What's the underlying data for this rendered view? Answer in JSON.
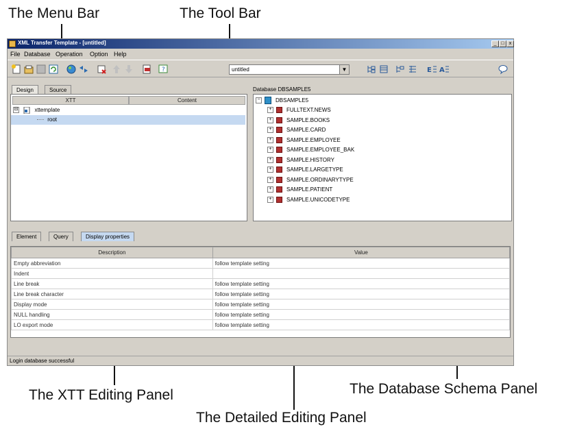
{
  "callouts": {
    "menu_bar": "The Menu Bar",
    "tool_bar": "The Tool Bar",
    "xtt_panel": "The XTT Editing Panel",
    "db_schema_panel": "The Database Schema Panel",
    "detailed_panel": "The Detailed Editing Panel"
  },
  "window": {
    "title": "XML Transfer Template - [untitled]",
    "controls": [
      "_",
      "□",
      "x"
    ]
  },
  "menu": [
    "File",
    "Database",
    "Operation",
    "Option",
    "Help"
  ],
  "toolbar": {
    "template_select_value": "untitled",
    "icons": [
      "new-template-icon",
      "open-template-icon",
      "save-template-icon",
      "refresh-icon",
      "connect-database-icon",
      "transfer-icon",
      "delete-icon",
      "move-up-icon",
      "move-down-icon",
      "export-icon",
      "help-icon",
      "tree-view-icon",
      "list-view-icon",
      "tree-detail-icon",
      "grid-icon",
      "element-icon",
      "attribute-icon",
      "comment-icon"
    ]
  },
  "xtt_panel": {
    "tabs": [
      "Design",
      "Source"
    ],
    "active_tab": "Design",
    "columns": [
      "XTT",
      "Content"
    ],
    "tree": [
      {
        "label": "xttemplate",
        "toggle": "⊟"
      },
      {
        "label": "root"
      }
    ]
  },
  "db_panel": {
    "title": "Database DBSAMPLE5",
    "root": "DBSAMPLE5",
    "tables": [
      "FULLTEXT.NEWS",
      "SAMPLE.BOOKS",
      "SAMPLE.CARD",
      "SAMPLE.EMPLOYEE",
      "SAMPLE.EMPLOYEE_BAK",
      "SAMPLE.HISTORY",
      "SAMPLE.LARGETYPE",
      "SAMPLE.ORDINARYTYPE",
      "SAMPLE.PATIENT",
      "SAMPLE.UNICODETYPE"
    ]
  },
  "detail_panel": {
    "tabs": [
      "Element",
      "Query",
      "Display properties"
    ],
    "active_tab": "Display properties",
    "columns": [
      "Description",
      "Value"
    ],
    "rows": [
      {
        "description": "Empty abbreviation",
        "value": "follow template setting"
      },
      {
        "description": "Indent",
        "value": ""
      },
      {
        "description": "Line break",
        "value": "follow template setting"
      },
      {
        "description": "Line break character",
        "value": "follow template setting"
      },
      {
        "description": "Display mode",
        "value": "follow template setting"
      },
      {
        "description": "NULL handling",
        "value": "follow template setting"
      },
      {
        "description": "LO export mode",
        "value": "follow template setting"
      }
    ]
  },
  "status": "Login database successful",
  "colors": {
    "titlebar_start": "#0a246a",
    "titlebar_end": "#a6caf0",
    "window_face": "#d4d0c8",
    "selection": "#c5d9f1"
  }
}
